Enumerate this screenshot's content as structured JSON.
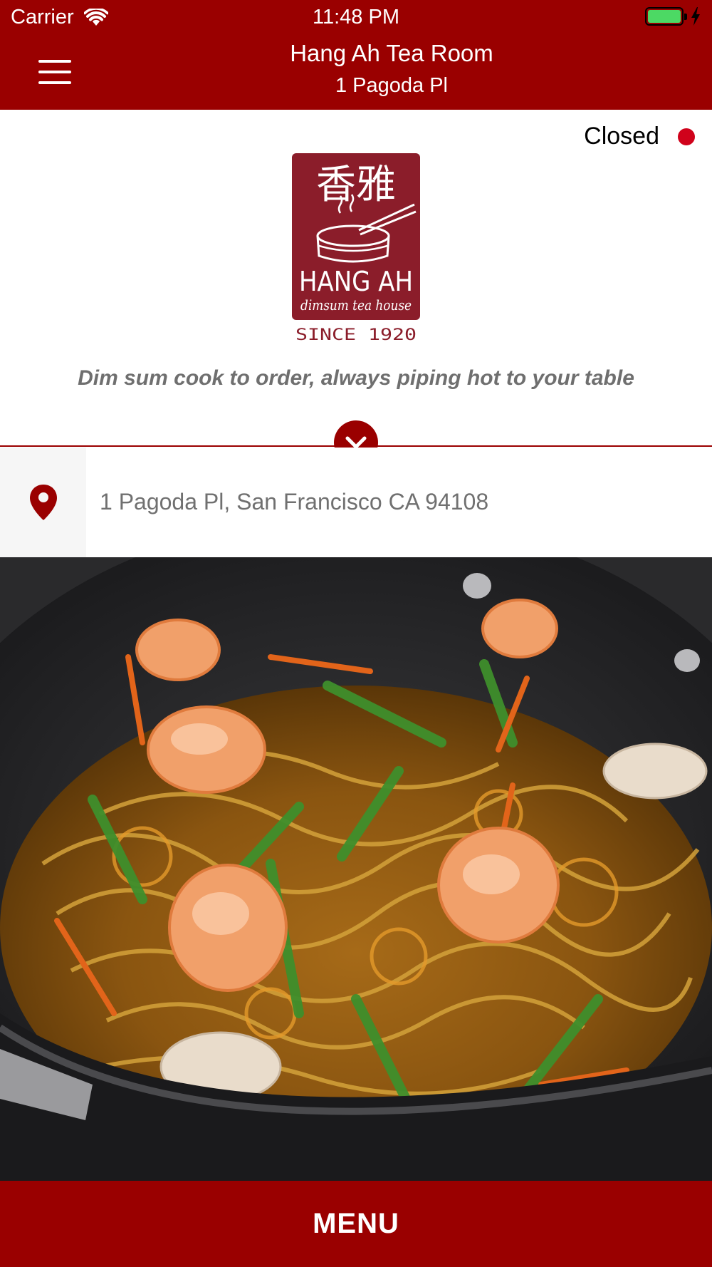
{
  "status_bar": {
    "carrier": "Carrier",
    "time": "11:48 PM",
    "wifi_icon": "wifi-icon",
    "battery_icon": "battery-icon",
    "charging_icon": "lightning-icon"
  },
  "header": {
    "menu_icon": "hamburger-menu-icon",
    "title": "Hang Ah Tea Room",
    "subtitle": "1 Pagoda Pl"
  },
  "status": {
    "label": "Closed",
    "dot_color": "#d0021b"
  },
  "logo": {
    "chinese": "香雅",
    "name": "HANG AH",
    "descriptor": "dimsum tea house",
    "since": "SINCE 1920"
  },
  "tagline": "Dim sum cook to order, always piping hot to your table",
  "expand_icon": "chevron-down-icon",
  "address": {
    "icon": "location-pin-icon",
    "text": "1 Pagoda Pl, San Francisco CA 94108"
  },
  "photo": {
    "subject": "wok-noodles-shrimp-photo"
  },
  "menu_button": {
    "label": "MENU"
  },
  "colors": {
    "brand": "#9a0000",
    "tagline": "#6f6f6f",
    "address_text": "#707070"
  }
}
